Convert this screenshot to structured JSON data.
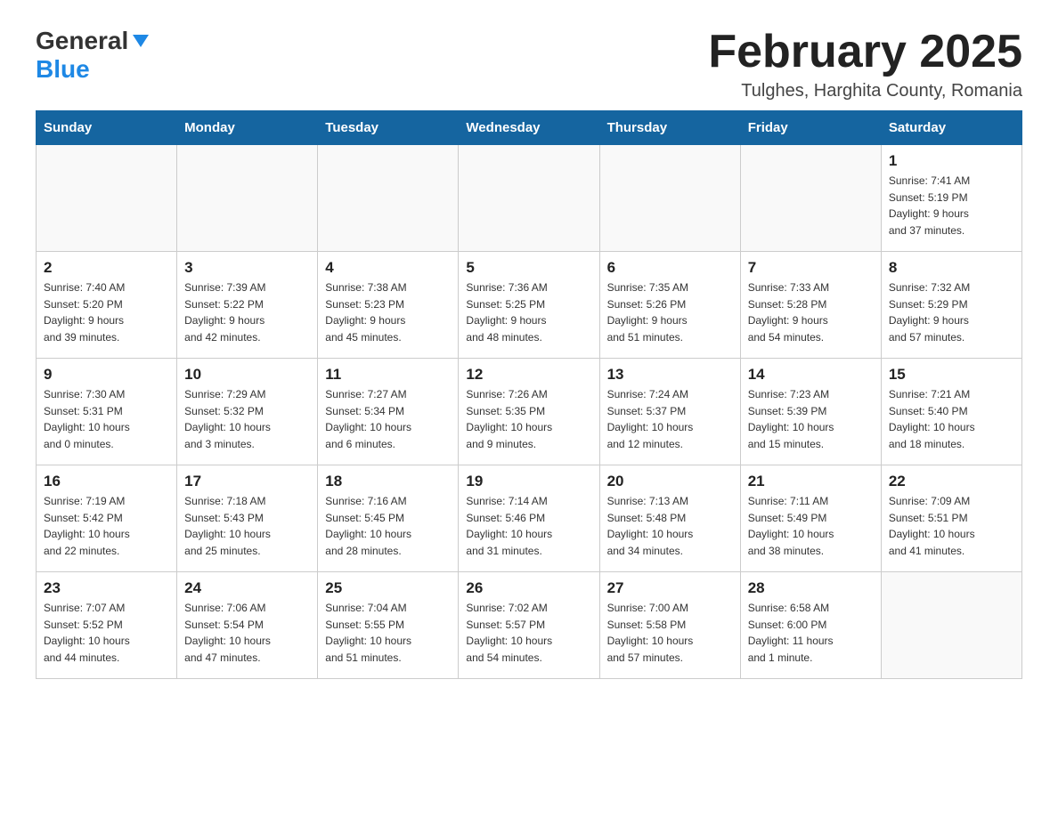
{
  "logo": {
    "general": "General",
    "blue": "Blue"
  },
  "title": "February 2025",
  "location": "Tulghes, Harghita County, Romania",
  "days_of_week": [
    "Sunday",
    "Monday",
    "Tuesday",
    "Wednesday",
    "Thursday",
    "Friday",
    "Saturday"
  ],
  "weeks": [
    [
      {
        "day": "",
        "info": ""
      },
      {
        "day": "",
        "info": ""
      },
      {
        "day": "",
        "info": ""
      },
      {
        "day": "",
        "info": ""
      },
      {
        "day": "",
        "info": ""
      },
      {
        "day": "",
        "info": ""
      },
      {
        "day": "1",
        "info": "Sunrise: 7:41 AM\nSunset: 5:19 PM\nDaylight: 9 hours\nand 37 minutes."
      }
    ],
    [
      {
        "day": "2",
        "info": "Sunrise: 7:40 AM\nSunset: 5:20 PM\nDaylight: 9 hours\nand 39 minutes."
      },
      {
        "day": "3",
        "info": "Sunrise: 7:39 AM\nSunset: 5:22 PM\nDaylight: 9 hours\nand 42 minutes."
      },
      {
        "day": "4",
        "info": "Sunrise: 7:38 AM\nSunset: 5:23 PM\nDaylight: 9 hours\nand 45 minutes."
      },
      {
        "day": "5",
        "info": "Sunrise: 7:36 AM\nSunset: 5:25 PM\nDaylight: 9 hours\nand 48 minutes."
      },
      {
        "day": "6",
        "info": "Sunrise: 7:35 AM\nSunset: 5:26 PM\nDaylight: 9 hours\nand 51 minutes."
      },
      {
        "day": "7",
        "info": "Sunrise: 7:33 AM\nSunset: 5:28 PM\nDaylight: 9 hours\nand 54 minutes."
      },
      {
        "day": "8",
        "info": "Sunrise: 7:32 AM\nSunset: 5:29 PM\nDaylight: 9 hours\nand 57 minutes."
      }
    ],
    [
      {
        "day": "9",
        "info": "Sunrise: 7:30 AM\nSunset: 5:31 PM\nDaylight: 10 hours\nand 0 minutes."
      },
      {
        "day": "10",
        "info": "Sunrise: 7:29 AM\nSunset: 5:32 PM\nDaylight: 10 hours\nand 3 minutes."
      },
      {
        "day": "11",
        "info": "Sunrise: 7:27 AM\nSunset: 5:34 PM\nDaylight: 10 hours\nand 6 minutes."
      },
      {
        "day": "12",
        "info": "Sunrise: 7:26 AM\nSunset: 5:35 PM\nDaylight: 10 hours\nand 9 minutes."
      },
      {
        "day": "13",
        "info": "Sunrise: 7:24 AM\nSunset: 5:37 PM\nDaylight: 10 hours\nand 12 minutes."
      },
      {
        "day": "14",
        "info": "Sunrise: 7:23 AM\nSunset: 5:39 PM\nDaylight: 10 hours\nand 15 minutes."
      },
      {
        "day": "15",
        "info": "Sunrise: 7:21 AM\nSunset: 5:40 PM\nDaylight: 10 hours\nand 18 minutes."
      }
    ],
    [
      {
        "day": "16",
        "info": "Sunrise: 7:19 AM\nSunset: 5:42 PM\nDaylight: 10 hours\nand 22 minutes."
      },
      {
        "day": "17",
        "info": "Sunrise: 7:18 AM\nSunset: 5:43 PM\nDaylight: 10 hours\nand 25 minutes."
      },
      {
        "day": "18",
        "info": "Sunrise: 7:16 AM\nSunset: 5:45 PM\nDaylight: 10 hours\nand 28 minutes."
      },
      {
        "day": "19",
        "info": "Sunrise: 7:14 AM\nSunset: 5:46 PM\nDaylight: 10 hours\nand 31 minutes."
      },
      {
        "day": "20",
        "info": "Sunrise: 7:13 AM\nSunset: 5:48 PM\nDaylight: 10 hours\nand 34 minutes."
      },
      {
        "day": "21",
        "info": "Sunrise: 7:11 AM\nSunset: 5:49 PM\nDaylight: 10 hours\nand 38 minutes."
      },
      {
        "day": "22",
        "info": "Sunrise: 7:09 AM\nSunset: 5:51 PM\nDaylight: 10 hours\nand 41 minutes."
      }
    ],
    [
      {
        "day": "23",
        "info": "Sunrise: 7:07 AM\nSunset: 5:52 PM\nDaylight: 10 hours\nand 44 minutes."
      },
      {
        "day": "24",
        "info": "Sunrise: 7:06 AM\nSunset: 5:54 PM\nDaylight: 10 hours\nand 47 minutes."
      },
      {
        "day": "25",
        "info": "Sunrise: 7:04 AM\nSunset: 5:55 PM\nDaylight: 10 hours\nand 51 minutes."
      },
      {
        "day": "26",
        "info": "Sunrise: 7:02 AM\nSunset: 5:57 PM\nDaylight: 10 hours\nand 54 minutes."
      },
      {
        "day": "27",
        "info": "Sunrise: 7:00 AM\nSunset: 5:58 PM\nDaylight: 10 hours\nand 57 minutes."
      },
      {
        "day": "28",
        "info": "Sunrise: 6:58 AM\nSunset: 6:00 PM\nDaylight: 11 hours\nand 1 minute."
      },
      {
        "day": "",
        "info": ""
      }
    ]
  ]
}
